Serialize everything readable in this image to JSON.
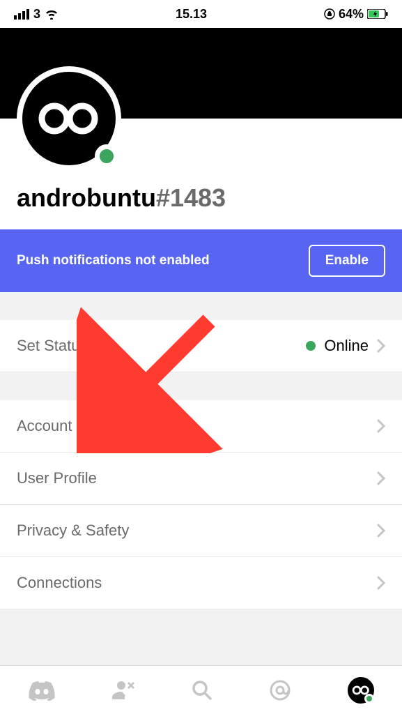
{
  "status_bar": {
    "carrier": "3",
    "time": "15.13",
    "battery": "64%"
  },
  "profile": {
    "username": "androbuntu",
    "discriminator": "#1483"
  },
  "notification": {
    "message": "Push notifications not enabled",
    "button": "Enable"
  },
  "status_row": {
    "label": "Set Status",
    "value": "Online"
  },
  "settings": [
    {
      "label": "Account"
    },
    {
      "label": "User Profile"
    },
    {
      "label": "Privacy & Safety"
    },
    {
      "label": "Connections"
    }
  ]
}
